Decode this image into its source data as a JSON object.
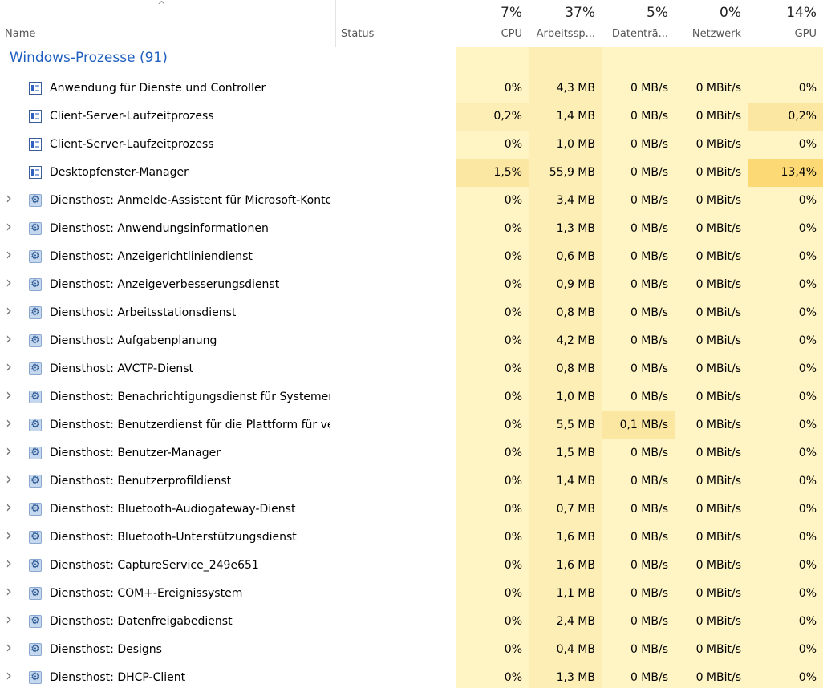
{
  "header": {
    "name_label": "Name",
    "status_label": "Status",
    "sort_indicator": "^",
    "columns": [
      {
        "pct": "7%",
        "label": "CPU"
      },
      {
        "pct": "37%",
        "label": "Arbeitssp..."
      },
      {
        "pct": "5%",
        "label": "Datenträ..."
      },
      {
        "pct": "0%",
        "label": "Netzwerk"
      },
      {
        "pct": "14%",
        "label": "GPU"
      }
    ]
  },
  "group": {
    "title": "Windows-Prozesse (91)"
  },
  "rows": [
    {
      "name": "Anwendung für Dienste und Controller",
      "icon": "window-icon",
      "expandable": false,
      "cpu": "0%",
      "mem": "4,3 MB",
      "disk": "0 MB/s",
      "net": "0 MBit/s",
      "gpu": "0%"
    },
    {
      "name": "Client-Server-Laufzeitprozess",
      "icon": "window-icon",
      "expandable": false,
      "cpu": "0,2%",
      "mem": "1,4 MB",
      "disk": "0 MB/s",
      "net": "0 MBit/s",
      "gpu": "0,2%"
    },
    {
      "name": "Client-Server-Laufzeitprozess",
      "icon": "window-icon",
      "expandable": false,
      "cpu": "0%",
      "mem": "1,0 MB",
      "disk": "0 MB/s",
      "net": "0 MBit/s",
      "gpu": "0%"
    },
    {
      "name": "Desktopfenster-Manager",
      "icon": "window-icon",
      "expandable": false,
      "cpu": "1,5%",
      "mem": "55,9 MB",
      "disk": "0 MB/s",
      "net": "0 MBit/s",
      "gpu": "13,4%"
    },
    {
      "name": "Diensthost: Anmelde-Assistent für Microsoft-Konten",
      "icon": "gear-icon",
      "expandable": true,
      "cpu": "0%",
      "mem": "3,4 MB",
      "disk": "0 MB/s",
      "net": "0 MBit/s",
      "gpu": "0%"
    },
    {
      "name": "Diensthost: Anwendungsinformationen",
      "icon": "gear-icon",
      "expandable": true,
      "cpu": "0%",
      "mem": "1,3 MB",
      "disk": "0 MB/s",
      "net": "0 MBit/s",
      "gpu": "0%"
    },
    {
      "name": "Diensthost: Anzeigerichtliniendienst",
      "icon": "gear-icon",
      "expandable": true,
      "cpu": "0%",
      "mem": "0,6 MB",
      "disk": "0 MB/s",
      "net": "0 MBit/s",
      "gpu": "0%"
    },
    {
      "name": "Diensthost: Anzeigeverbesserungsdienst",
      "icon": "gear-icon",
      "expandable": true,
      "cpu": "0%",
      "mem": "0,9 MB",
      "disk": "0 MB/s",
      "net": "0 MBit/s",
      "gpu": "0%"
    },
    {
      "name": "Diensthost: Arbeitsstationsdienst",
      "icon": "gear-icon",
      "expandable": true,
      "cpu": "0%",
      "mem": "0,8 MB",
      "disk": "0 MB/s",
      "net": "0 MBit/s",
      "gpu": "0%"
    },
    {
      "name": "Diensthost: Aufgabenplanung",
      "icon": "gear-icon",
      "expandable": true,
      "cpu": "0%",
      "mem": "4,2 MB",
      "disk": "0 MB/s",
      "net": "0 MBit/s",
      "gpu": "0%"
    },
    {
      "name": "Diensthost: AVCTP-Dienst",
      "icon": "gear-icon",
      "expandable": true,
      "cpu": "0%",
      "mem": "0,8 MB",
      "disk": "0 MB/s",
      "net": "0 MBit/s",
      "gpu": "0%"
    },
    {
      "name": "Diensthost: Benachrichtigungsdienst für Systemerei...",
      "icon": "gear-icon",
      "expandable": true,
      "cpu": "0%",
      "mem": "1,0 MB",
      "disk": "0 MB/s",
      "net": "0 MBit/s",
      "gpu": "0%"
    },
    {
      "name": "Diensthost: Benutzerdienst für die Plattform für ver...",
      "icon": "gear-icon",
      "expandable": true,
      "cpu": "0%",
      "mem": "5,5 MB",
      "disk": "0,1 MB/s",
      "net": "0 MBit/s",
      "gpu": "0%"
    },
    {
      "name": "Diensthost: Benutzer-Manager",
      "icon": "gear-icon",
      "expandable": true,
      "cpu": "0%",
      "mem": "1,5 MB",
      "disk": "0 MB/s",
      "net": "0 MBit/s",
      "gpu": "0%"
    },
    {
      "name": "Diensthost: Benutzerprofildienst",
      "icon": "gear-icon",
      "expandable": true,
      "cpu": "0%",
      "mem": "1,4 MB",
      "disk": "0 MB/s",
      "net": "0 MBit/s",
      "gpu": "0%"
    },
    {
      "name": "Diensthost: Bluetooth-Audiogateway-Dienst",
      "icon": "gear-icon",
      "expandable": true,
      "cpu": "0%",
      "mem": "0,7 MB",
      "disk": "0 MB/s",
      "net": "0 MBit/s",
      "gpu": "0%"
    },
    {
      "name": "Diensthost: Bluetooth-Unterstützungsdienst",
      "icon": "gear-icon",
      "expandable": true,
      "cpu": "0%",
      "mem": "1,6 MB",
      "disk": "0 MB/s",
      "net": "0 MBit/s",
      "gpu": "0%"
    },
    {
      "name": "Diensthost: CaptureService_249e651",
      "icon": "gear-icon",
      "expandable": true,
      "cpu": "0%",
      "mem": "1,6 MB",
      "disk": "0 MB/s",
      "net": "0 MBit/s",
      "gpu": "0%"
    },
    {
      "name": "Diensthost: COM+-Ereignissystem",
      "icon": "gear-icon",
      "expandable": true,
      "cpu": "0%",
      "mem": "1,1 MB",
      "disk": "0 MB/s",
      "net": "0 MBit/s",
      "gpu": "0%"
    },
    {
      "name": "Diensthost: Datenfreigabedienst",
      "icon": "gear-icon",
      "expandable": true,
      "cpu": "0%",
      "mem": "2,4 MB",
      "disk": "0 MB/s",
      "net": "0 MBit/s",
      "gpu": "0%"
    },
    {
      "name": "Diensthost: Designs",
      "icon": "gear-icon",
      "expandable": true,
      "cpu": "0%",
      "mem": "0,4 MB",
      "disk": "0 MB/s",
      "net": "0 MBit/s",
      "gpu": "0%"
    },
    {
      "name": "Diensthost: DHCP-Client",
      "icon": "gear-icon",
      "expandable": true,
      "cpu": "0%",
      "mem": "1,3 MB",
      "disk": "0 MB/s",
      "net": "0 MBit/s",
      "gpu": "0%"
    }
  ]
}
